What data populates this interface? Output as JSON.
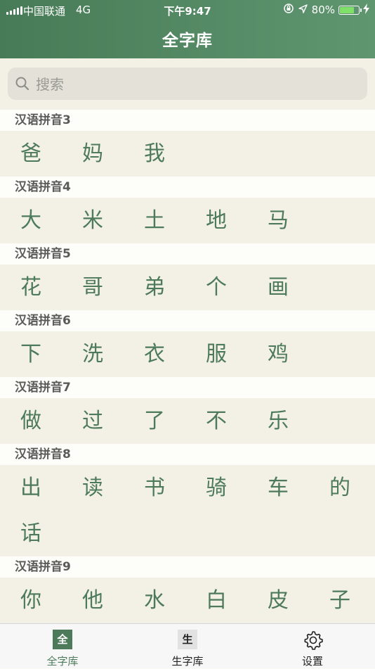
{
  "status": {
    "carrier": "中国联通",
    "network": "4G",
    "time": "下午9:47",
    "battery": "80%",
    "battery_level": 0.8
  },
  "nav": {
    "title": "全字库"
  },
  "search": {
    "placeholder": "搜索"
  },
  "sections": [
    {
      "title": "汉语拼音3",
      "chars": [
        "爸",
        "妈",
        "我"
      ]
    },
    {
      "title": "汉语拼音4",
      "chars": [
        "大",
        "米",
        "土",
        "地",
        "马"
      ]
    },
    {
      "title": "汉语拼音5",
      "chars": [
        "花",
        "哥",
        "弟",
        "个",
        "画"
      ]
    },
    {
      "title": "汉语拼音6",
      "chars": [
        "下",
        "洗",
        "衣",
        "服",
        "鸡"
      ]
    },
    {
      "title": "汉语拼音7",
      "chars": [
        "做",
        "过",
        "了",
        "不",
        "乐"
      ]
    },
    {
      "title": "汉语拼音8",
      "chars": [
        "出",
        "读",
        "书",
        "骑",
        "车",
        "的",
        "话"
      ]
    },
    {
      "title": "汉语拼音9",
      "chars": [
        "你",
        "他",
        "水",
        "白",
        "皮",
        "子"
      ]
    }
  ],
  "tabs": [
    {
      "icon": "全",
      "label": "全字库",
      "active": true
    },
    {
      "icon": "生",
      "label": "生字库",
      "active": false
    },
    {
      "icon": "gear-icon",
      "label": "设置",
      "active": false
    }
  ],
  "colors": {
    "accent": "#4e7a5c",
    "header_from": "#477b57",
    "header_to": "#5f9670",
    "battery": "#7fe06a"
  }
}
